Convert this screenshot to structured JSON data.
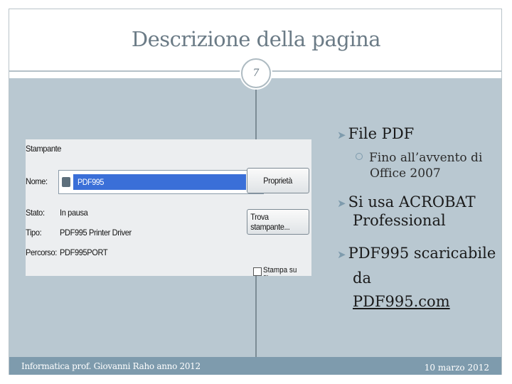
{
  "slide": {
    "title": "Descrizione della pagina",
    "page_number": "7"
  },
  "screenshot": {
    "labels": {
      "stampante": "Stampante",
      "nome": "Nome:",
      "stato": "Stato:",
      "tipo": "Tipo:",
      "percorso": "Percorso:"
    },
    "values": {
      "stato": "In pausa",
      "tipo": "PDF995 Printer Driver",
      "percorso": "PDF995PORT"
    },
    "printer_select": "PDF995",
    "buttons": {
      "properties": "Proprietà",
      "find_printer": "Trova stampante..."
    },
    "checkbox_label": "Stampa su file"
  },
  "bullets": [
    {
      "text": "File PDF"
    },
    {
      "text": "Fino all’avvento di Office 2007"
    },
    {
      "text": "Si usa ACROBAT Professional"
    },
    {
      "text": "PDF995 scaricabile da",
      "link": "PDF995.com"
    }
  ],
  "footer": {
    "left": "Informatica prof. Giovanni Raho anno 2012",
    "right": "10 marzo 2012"
  },
  "colors": {
    "accent": "#7e9bad",
    "content_bg": "#b9c8d1",
    "title_text": "#6b7b86",
    "selection": "#3a6fd8"
  }
}
